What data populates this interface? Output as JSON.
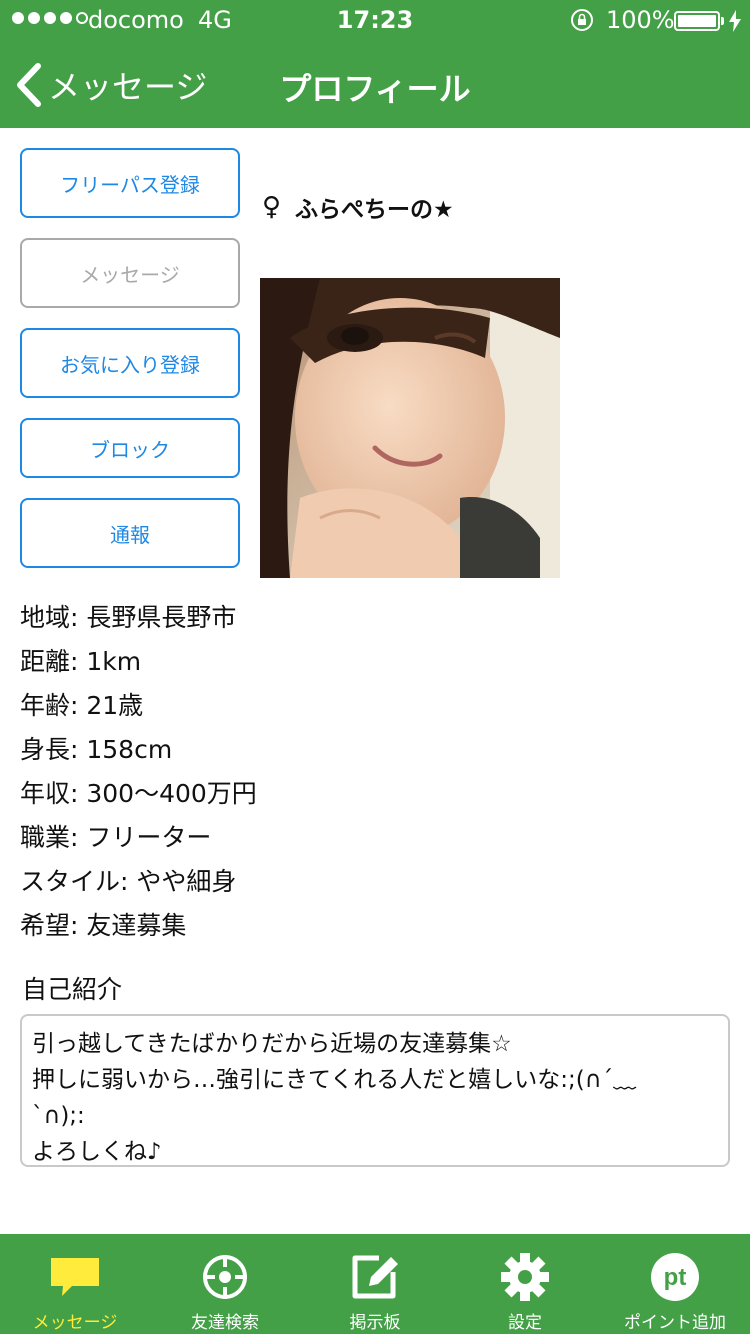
{
  "status_bar": {
    "carrier": "docomo",
    "network": "4G",
    "time": "17:23",
    "battery": "100%",
    "signal_bars_filled": 4,
    "signal_bars_total": 5
  },
  "nav": {
    "back_label": "メッセージ",
    "title": "プロフィール"
  },
  "actions": {
    "freepass": "フリーパス登録",
    "message": "メッセージ",
    "favorite": "お気に入り登録",
    "block": "ブロック",
    "report": "通報"
  },
  "profile": {
    "gender_symbol": "♀",
    "name": "ふらぺちーの★",
    "details": [
      "地域: 長野県長野市",
      "距離: 1km",
      "年齢: 21歳",
      "身長: 158cm",
      "年収: 300～400万円",
      "職業: フリーター",
      "スタイル: やや細身",
      "希望: 友達募集"
    ],
    "intro_heading": "自己紹介",
    "intro_lines": [
      "引っ越してきたばかりだから近場の友達募集☆",
      "押しに弱いから…強引にきてくれる人だと嬉しいな:;(∩´﹏",
      "`∩);:",
      "よろしくね♪"
    ]
  },
  "tabs": [
    {
      "label": "メッセージ",
      "icon": "speech-bubble-icon",
      "active": true
    },
    {
      "label": "友達検索",
      "icon": "crosshair-icon",
      "active": false
    },
    {
      "label": "掲示板",
      "icon": "edit-board-icon",
      "active": false
    },
    {
      "label": "設定",
      "icon": "gear-icon",
      "active": false
    },
    {
      "label": "ポイント追加",
      "icon": "points-icon",
      "active": false
    }
  ],
  "colors": {
    "brand_green": "#43a047",
    "link_blue": "#1e88e5",
    "active_tab": "#ffeb3b"
  }
}
